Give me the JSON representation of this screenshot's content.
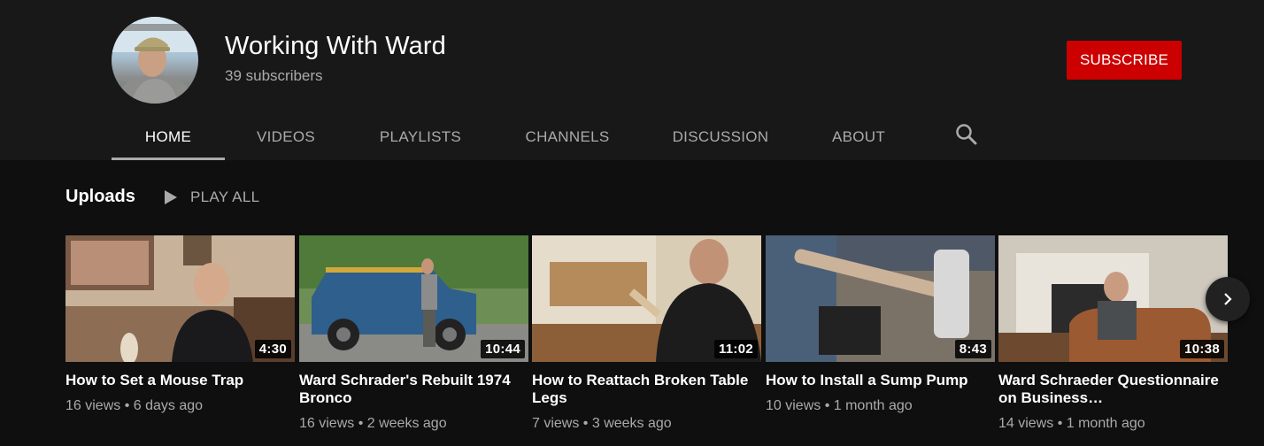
{
  "channel": {
    "name": "Working With Ward",
    "subscribers": "39 subscribers",
    "subscribe_label": "SUBSCRIBE",
    "accent_color": "#cc0000"
  },
  "tabs": [
    {
      "label": "HOME",
      "active": true
    },
    {
      "label": "VIDEOS",
      "active": false
    },
    {
      "label": "PLAYLISTS",
      "active": false
    },
    {
      "label": "CHANNELS",
      "active": false
    },
    {
      "label": "DISCUSSION",
      "active": false
    },
    {
      "label": "ABOUT",
      "active": false
    }
  ],
  "search_icon": "search-icon",
  "section": {
    "title": "Uploads",
    "play_all_label": "PLAY ALL"
  },
  "videos": [
    {
      "title": "How to Set a Mouse Trap",
      "duration": "4:30",
      "views": "16 views",
      "age": "6 days ago"
    },
    {
      "title": "Ward Schrader's Rebuilt 1974 Bronco",
      "duration": "10:44",
      "views": "16 views",
      "age": "2 weeks ago"
    },
    {
      "title": "How to Reattach Broken Table Legs",
      "duration": "11:02",
      "views": "7 views",
      "age": "3 weeks ago"
    },
    {
      "title": "How to Install a Sump Pump",
      "duration": "8:43",
      "views": "10 views",
      "age": "1 month ago"
    },
    {
      "title": "Ward Schraeder Questionnaire on Business…",
      "duration": "10:38",
      "views": "14 views",
      "age": "1 month ago"
    }
  ],
  "next_icon": "chevron-right-icon"
}
